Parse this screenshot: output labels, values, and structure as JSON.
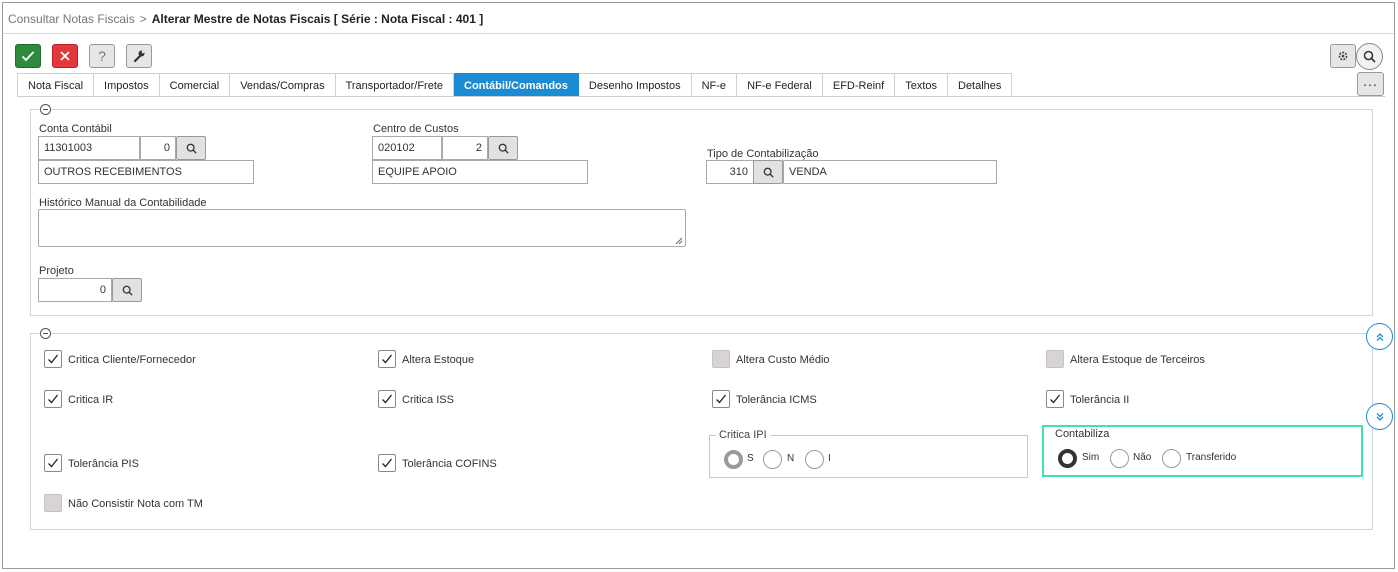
{
  "breadcrumb": {
    "parent": "Consultar Notas Fiscais",
    "separator": ">",
    "current": "Alterar Mestre de Notas Fiscais [ Série : Nota Fiscal : 401 ]"
  },
  "toolbar": {
    "help_label": "?",
    "more_label": "..."
  },
  "tabs": [
    {
      "label": "Nota Fiscal"
    },
    {
      "label": "Impostos"
    },
    {
      "label": "Comercial"
    },
    {
      "label": "Vendas/Compras"
    },
    {
      "label": "Transportador/Frete"
    },
    {
      "label": "Contábil/Comandos",
      "active": true
    },
    {
      "label": "Desenho Impostos"
    },
    {
      "label": "NF-e"
    },
    {
      "label": "NF-e Federal"
    },
    {
      "label": "EFD-Reinf"
    },
    {
      "label": "Textos"
    },
    {
      "label": "Detalhes"
    }
  ],
  "contabil": {
    "conta_contabil": {
      "label": "Conta Contábil",
      "code": "11301003",
      "digit": "0",
      "description": "OUTROS RECEBIMENTOS"
    },
    "centro_custos": {
      "label": "Centro de Custos",
      "code": "020102",
      "digit": "2",
      "description": "EQUIPE APOIO"
    },
    "tipo_contabilizacao": {
      "label": "Tipo de Contabilização",
      "code": "310",
      "description": "VENDA"
    },
    "historico": {
      "label": "Histórico Manual da Contabilidade",
      "value": ""
    },
    "projeto": {
      "label": "Projeto",
      "value": "0"
    }
  },
  "checkboxes": [
    {
      "label": "Critica Cliente/Fornecedor",
      "checked": true
    },
    {
      "label": "Altera Estoque",
      "checked": true
    },
    {
      "label": "Altera Custo Médio",
      "checked": false
    },
    {
      "label": "Altera Estoque de Terceiros",
      "checked": false
    },
    {
      "label": "Critica IR",
      "checked": true
    },
    {
      "label": "Critica ISS",
      "checked": true
    },
    {
      "label": "Tolerância ICMS",
      "checked": true
    },
    {
      "label": "Tolerância II",
      "checked": true
    },
    {
      "label": "Tolerância PIS",
      "checked": true
    },
    {
      "label": "Tolerância COFINS",
      "checked": true
    },
    {
      "label": "Não Consistir Nota com TM",
      "checked": false
    }
  ],
  "critica_ipi": {
    "title": "Critica IPI",
    "options": [
      "S",
      "N",
      "I"
    ],
    "selected": "S"
  },
  "contabiliza": {
    "title": "Contabiliza",
    "options": [
      "Sim",
      "Não",
      "Transferido"
    ],
    "selected": "Sim",
    "highlight_color": "#3fe3b0"
  },
  "colors": {
    "accent": "#1a8bd4",
    "confirm": "#2e8b3e",
    "cancel": "#e2383b"
  }
}
